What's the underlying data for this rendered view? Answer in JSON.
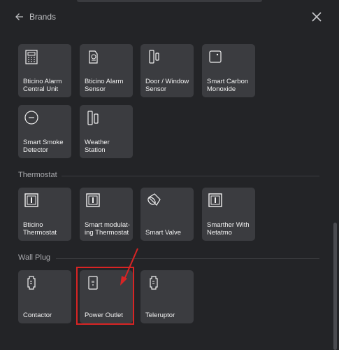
{
  "header": {
    "back_label": "Brands"
  },
  "sections": {
    "thermostat": "Thermostat",
    "wall_plug": "Wall Plug"
  },
  "tiles": {
    "alarm_central": "Bticino Alarm Central Unit",
    "alarm_sensor": "Bticino Alarm Sensor",
    "door_window": "Door / Window Sensor",
    "smart_co": "Smart Carbon Monoxide",
    "smoke_detector": "Smart Smoke Detector",
    "weather_station": "Weather Station",
    "bticino_thermostat": "Bticino Thermostat",
    "smart_modulating": "Smart modulat-ing Thermostat",
    "smart_valve": "Smart Valve",
    "smarther": "Smarther With Netatmo",
    "contactor": "Contactor",
    "power_outlet": "Power Outlet",
    "teleruptor": "Teleruptor"
  },
  "colors": {
    "background": "#232427",
    "tile": "#3b3c40",
    "highlight": "#d82424"
  }
}
